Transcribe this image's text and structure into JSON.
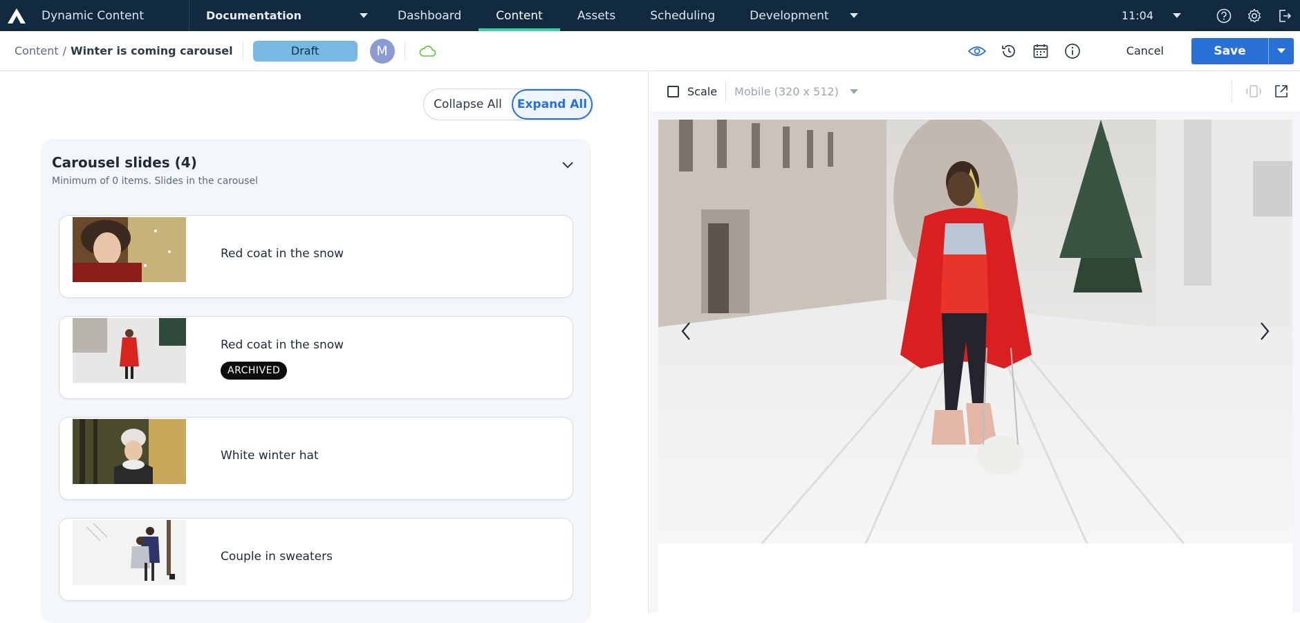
{
  "app": {
    "title": "Dynamic Content"
  },
  "hub": {
    "label": "Documentation"
  },
  "nav": {
    "tabs": [
      {
        "label": "Dashboard"
      },
      {
        "label": "Content"
      },
      {
        "label": "Assets"
      },
      {
        "label": "Scheduling"
      },
      {
        "label": "Development"
      }
    ],
    "time": "11:04",
    "icons": [
      "help-icon",
      "gear-icon",
      "logout-icon"
    ]
  },
  "toolbar": {
    "breadcrumb_root": "Content",
    "breadcrumb_sep": "/",
    "breadcrumb_current": "Winter is coming carousel",
    "status": "Draft",
    "avatar_initial": "M",
    "cancel_label": "Cancel",
    "save_label": "Save",
    "icons": [
      "eye-icon",
      "history-icon",
      "calendar-icon",
      "info-icon",
      "cloud-icon"
    ]
  },
  "editor": {
    "collapse_label": "Collapse All",
    "expand_label": "Expand All",
    "group_title": "Carousel slides (4)",
    "group_description": "Minimum of 0 items. Slides in the carousel",
    "slides": [
      {
        "title": "Red coat in the snow",
        "badge": ""
      },
      {
        "title": "Red coat in the snow",
        "badge": "ARCHIVED"
      },
      {
        "title": "White winter hat",
        "badge": ""
      },
      {
        "title": "Couple in sweaters",
        "badge": ""
      }
    ]
  },
  "preview": {
    "scale_label": "Scale",
    "device": "Mobile (320 x 512)",
    "icons": [
      "rotate-icon",
      "open-external-icon"
    ]
  },
  "colors": {
    "nav_bg": "#112a3f",
    "accent": "#2870d6",
    "active_tab_underline": "#32d3a3",
    "draft_pill": "#77b9e3"
  }
}
